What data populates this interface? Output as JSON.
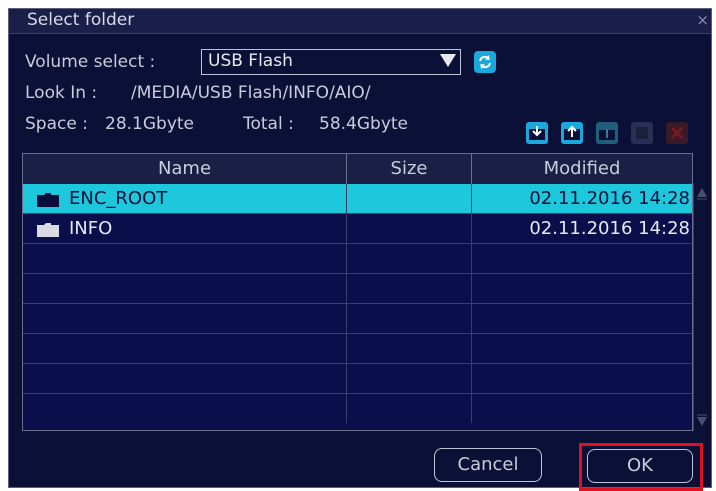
{
  "dialog": {
    "title": "Select folder",
    "close_glyph": "×",
    "volume_label": "Volume select :",
    "volume_value": "USB Flash",
    "lookin_label": "Look In :",
    "lookin_path": "/MEDIA/USB Flash/INFO/AIO/",
    "space_label": "Space :",
    "space_value": "28.1Gbyte",
    "total_label": "Total :",
    "total_value": "58.4Gbyte",
    "toolbar_icons": [
      "import-folder-icon",
      "export-folder-icon",
      "folder-up-icon",
      "properties-icon",
      "delete-icon"
    ]
  },
  "table": {
    "columns": [
      "Name",
      "Size",
      "Modified"
    ],
    "rows": [
      {
        "name": "ENC_ROOT",
        "size": "",
        "modified": "02.11.2016 14:28",
        "selected": true
      },
      {
        "name": "INFO",
        "size": "",
        "modified": "02.11.2016 14:28",
        "selected": false
      }
    ],
    "empty_rows": 6
  },
  "buttons": {
    "cancel": "Cancel",
    "ok": "OK"
  },
  "colors": {
    "background": "#0b1036",
    "selection": "#1ec8dc",
    "accent": "#1aa8dd",
    "highlight_border": "#e01020"
  }
}
